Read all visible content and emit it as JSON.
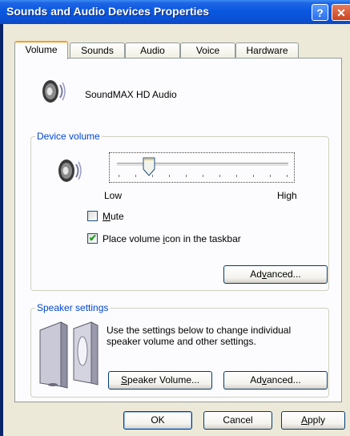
{
  "window": {
    "title": "Sounds and Audio Devices Properties",
    "help_glyph": "?",
    "close_glyph": "✕"
  },
  "tabs": [
    {
      "label": "Volume",
      "active": true
    },
    {
      "label": "Sounds",
      "active": false
    },
    {
      "label": "Audio",
      "active": false
    },
    {
      "label": "Voice",
      "active": false
    },
    {
      "label": "Hardware",
      "active": false
    }
  ],
  "device": {
    "name": "SoundMAX HD Audio",
    "icon": "speaker-icon"
  },
  "device_volume": {
    "group_title": "Device volume",
    "slider_low_label": "Low",
    "slider_high_label": "High",
    "level": 0.18,
    "mute": {
      "label_key": "M",
      "label_rest": "ute",
      "checked": false
    },
    "taskbar_icon": {
      "label_pre": "Place volume ",
      "label_key": "i",
      "label_post": "con in the taskbar",
      "checked": true
    },
    "advanced_button": {
      "pre": "Ad",
      "key": "v",
      "post": "anced..."
    }
  },
  "speaker_settings": {
    "group_title": "Speaker settings",
    "description": "Use the settings below to change individual speaker volume and other settings.",
    "speaker_volume_button": {
      "pre": "",
      "key": "S",
      "post": "peaker Volume..."
    },
    "advanced_button": {
      "pre": "Ad",
      "key": "v",
      "post": "anced..."
    }
  },
  "footer": {
    "ok": "OK",
    "cancel": "Cancel",
    "apply": {
      "pre": "",
      "key": "A",
      "post": "pply"
    }
  },
  "colors": {
    "titlebar": "#0a52d6",
    "group_title": "#0046d5",
    "tab_highlight": "#ff9a14",
    "check": "#21a121"
  }
}
